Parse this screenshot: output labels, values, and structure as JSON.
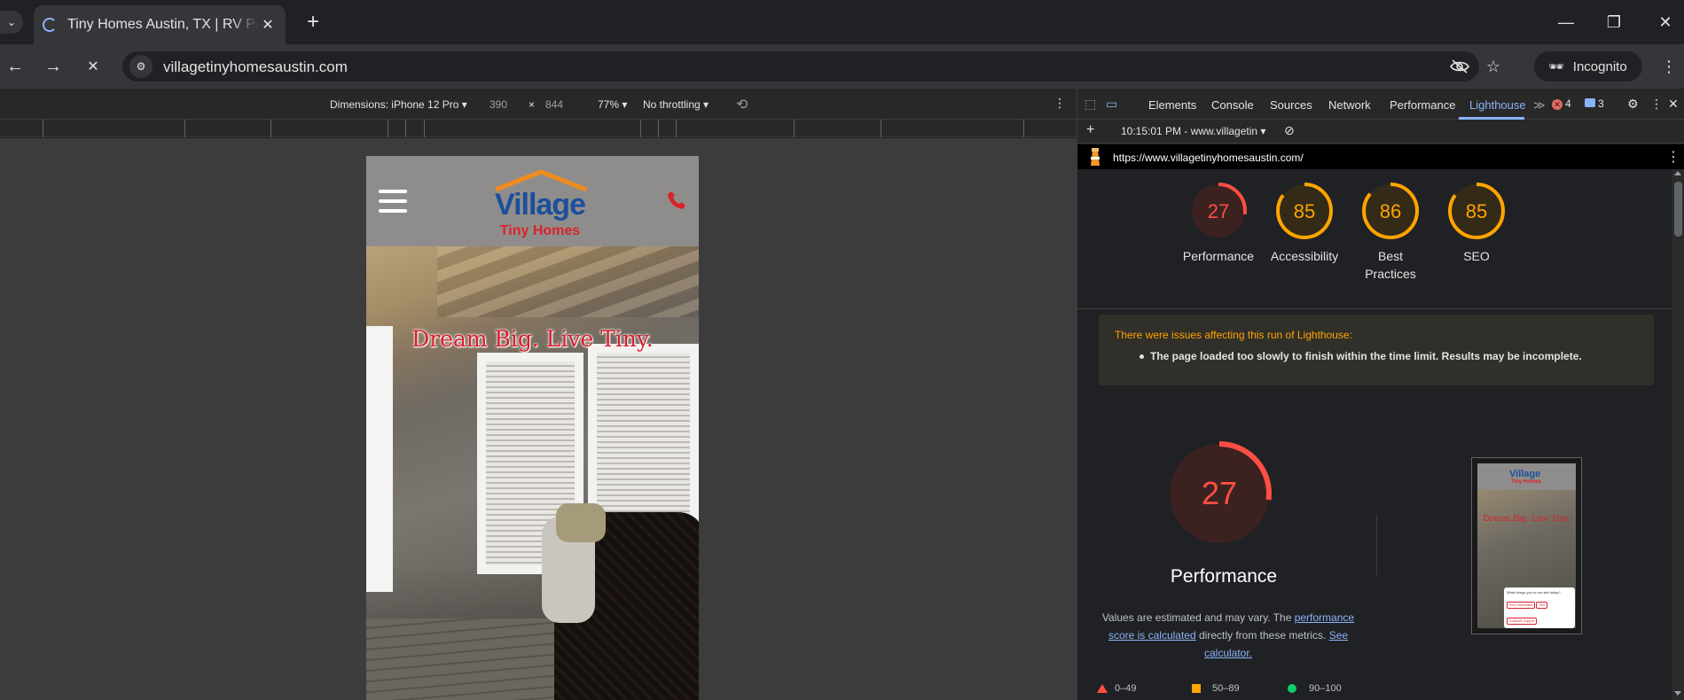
{
  "browser": {
    "tab_title": "Tiny Homes Austin, TX | RV Park & Tiny Home Community",
    "tab_close": "✕",
    "new_tab": "+",
    "url": "villagetinyhomesaustin.com",
    "incognito_label": "Incognito",
    "window_minimize": "—",
    "window_restore": "❐",
    "window_close": "✕"
  },
  "device_toolbar": {
    "dimensions_label": "Dimensions: iPhone 12 Pro",
    "width": "390",
    "times": "×",
    "height": "844",
    "zoom": "77%",
    "throttling": "No throttling"
  },
  "site": {
    "logo_main": "Village",
    "logo_sub": "Tiny Homes",
    "tagline": "Dream Big. Live Tiny."
  },
  "devtools": {
    "tabs": [
      "Elements",
      "Console",
      "Sources",
      "Network",
      "Performance",
      "Lighthouse"
    ],
    "more_tabs": "≫",
    "error_count": "4",
    "message_count": "3",
    "report_time": "10:15:01 PM - www.villagetin",
    "report_url": "https://www.villagetinyhomesaustin.com/"
  },
  "lighthouse": {
    "scores": [
      {
        "label": "Performance",
        "value": "27",
        "score": 27,
        "status": "fail"
      },
      {
        "label": "Accessibility",
        "value": "85",
        "score": 85,
        "status": "average"
      },
      {
        "label": "Best Practices",
        "value": "86",
        "score": 86,
        "status": "average"
      },
      {
        "label": "SEO",
        "value": "85",
        "score": 85,
        "status": "average"
      }
    ],
    "warning_title": "There were issues affecting this run of Lighthouse:",
    "warning_item": "The page loaded too slowly to finish within the time limit. Results may be incomplete.",
    "big_score": "27",
    "big_score_value": 27,
    "big_title": "Performance",
    "desc_prefix": "Values are estimated and may vary. The ",
    "desc_link1": "performance score is calculated",
    "desc_mid": " directly from these metrics. ",
    "desc_link2": "See calculator.",
    "legend": [
      "0–49",
      "50–89",
      "90–100"
    ],
    "thumb_logo": "Village",
    "thumb_logo_sub": "Tiny Homes",
    "thumb_tagline": "Dream Big. Live Tiny.",
    "thumb_popup_title": "What brings you to our site today?",
    "thumb_buttons": [
      "Price Information",
      "Tour",
      "Customer Support"
    ]
  },
  "colors": {
    "fail": "#ff4e42",
    "average": "#ffa400",
    "pass": "#0cce6b",
    "link": "#8ab4f8"
  }
}
